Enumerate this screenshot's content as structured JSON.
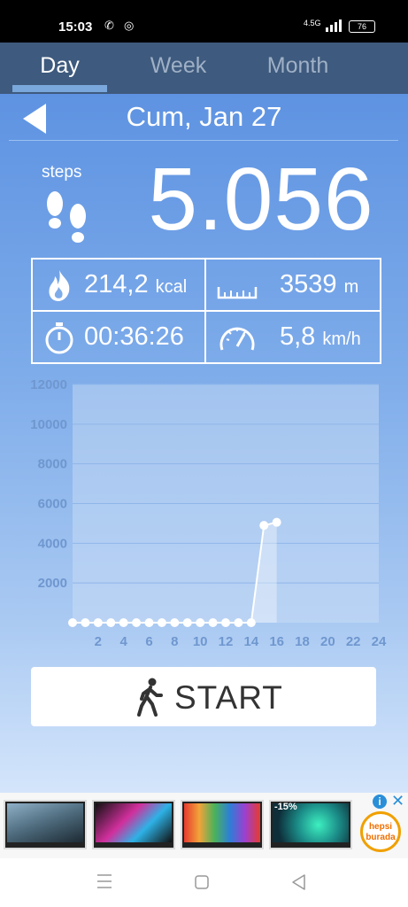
{
  "status_bar": {
    "time": "15:03",
    "battery": "76",
    "network": "4.5G"
  },
  "tabs": [
    {
      "label": "Day",
      "active": true
    },
    {
      "label": "Week",
      "active": false
    },
    {
      "label": "Month",
      "active": false
    }
  ],
  "header": {
    "date": "Cum, Jan 27"
  },
  "steps": {
    "label": "steps",
    "value": "5.056"
  },
  "stats": {
    "calories": {
      "value": "214,2",
      "unit": "kcal",
      "icon": "flame-icon"
    },
    "distance": {
      "value": "3539",
      "unit": "m",
      "icon": "ruler-icon"
    },
    "duration": {
      "value": "00:36:26",
      "icon": "stopwatch-icon"
    },
    "speed": {
      "value": "5,8",
      "unit": "km/h",
      "icon": "speedometer-icon"
    }
  },
  "chart_data": {
    "type": "line",
    "x": [
      0,
      1,
      2,
      3,
      4,
      5,
      6,
      7,
      8,
      9,
      10,
      11,
      12,
      13,
      14,
      15,
      16
    ],
    "values": [
      0,
      0,
      0,
      0,
      0,
      0,
      0,
      0,
      0,
      0,
      0,
      0,
      0,
      0,
      0,
      4900,
      5056
    ],
    "xticks": [
      "2",
      "4",
      "6",
      "8",
      "10",
      "12",
      "14",
      "16",
      "18",
      "20",
      "22",
      "24"
    ],
    "yticks": [
      "2000",
      "4000",
      "6000",
      "8000",
      "10000",
      "12000"
    ],
    "xlim": [
      0,
      24
    ],
    "ylim": [
      0,
      12000
    ],
    "grid": true
  },
  "start_button": {
    "label": "START"
  },
  "colors": {
    "tab_bar": "#3e5a7e",
    "background_top": "#5e93e2",
    "background_bottom": "#d4e5fb",
    "accent": "#ffffff"
  },
  "ad": {
    "discount": "-15%",
    "brand": "hepsi burada"
  }
}
